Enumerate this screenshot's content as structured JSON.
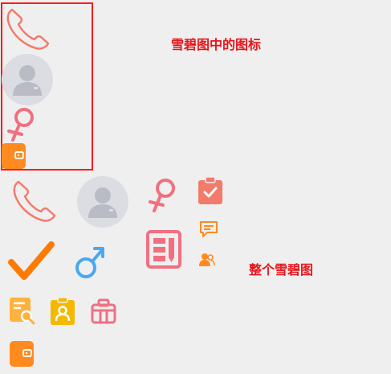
{
  "labels": {
    "sprite_icons": "雪碧图中的图标",
    "full_sprite": "整个雪碧图"
  },
  "icons": [
    "phone-icon",
    "avatar-icon",
    "female-icon",
    "wallet-icon",
    "clipboard-check-icon",
    "message-icon",
    "users-icon",
    "report-card-icon",
    "check-icon",
    "male-icon",
    "doc-search-icon",
    "clipboard-user-icon",
    "briefcase-icon"
  ],
  "colors": {
    "label": "#e8151b",
    "frame": "#ff1a1a",
    "coral": "#f27b6b",
    "orange": "#ff8a1f",
    "pink": "#f07080",
    "blue": "#4aa8f0",
    "yellow": "#f5b800",
    "avatar_bg": "#dcdde2",
    "avatar_fg": "#b9bcc4"
  }
}
